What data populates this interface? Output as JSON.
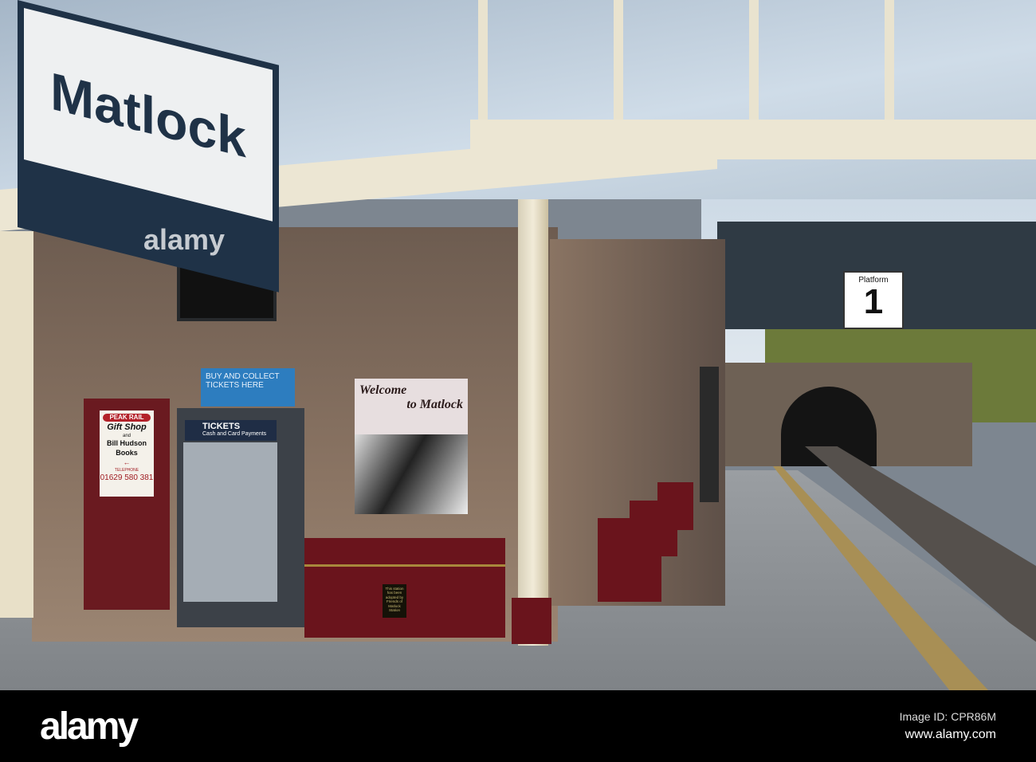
{
  "station_sign": "Matlock",
  "shop_sign": {
    "brand": "PEAK RAIL",
    "line1": "Gift Shop",
    "line2": "and",
    "line3": "Bill Hudson",
    "line4": "Books",
    "tel_label": "TELEPHONE",
    "phone": "01629 580 381"
  },
  "buy_sign": "BUY AND COLLECT TICKETS HERE",
  "ticket_machine": {
    "title": "TICKETS",
    "subtitle": "Cash and Card Payments"
  },
  "welcome_sign": {
    "line1": "Welcome",
    "line2": "to Matlock"
  },
  "plaque": "This station has been adopted by Friends of Matlock Station",
  "platform_sign": {
    "label": "Platform",
    "number": "1"
  },
  "watermark": "alamy",
  "footer": {
    "logo": "alamy",
    "image_id": "Image ID: CPR86M",
    "site": "www.alamy.com"
  }
}
